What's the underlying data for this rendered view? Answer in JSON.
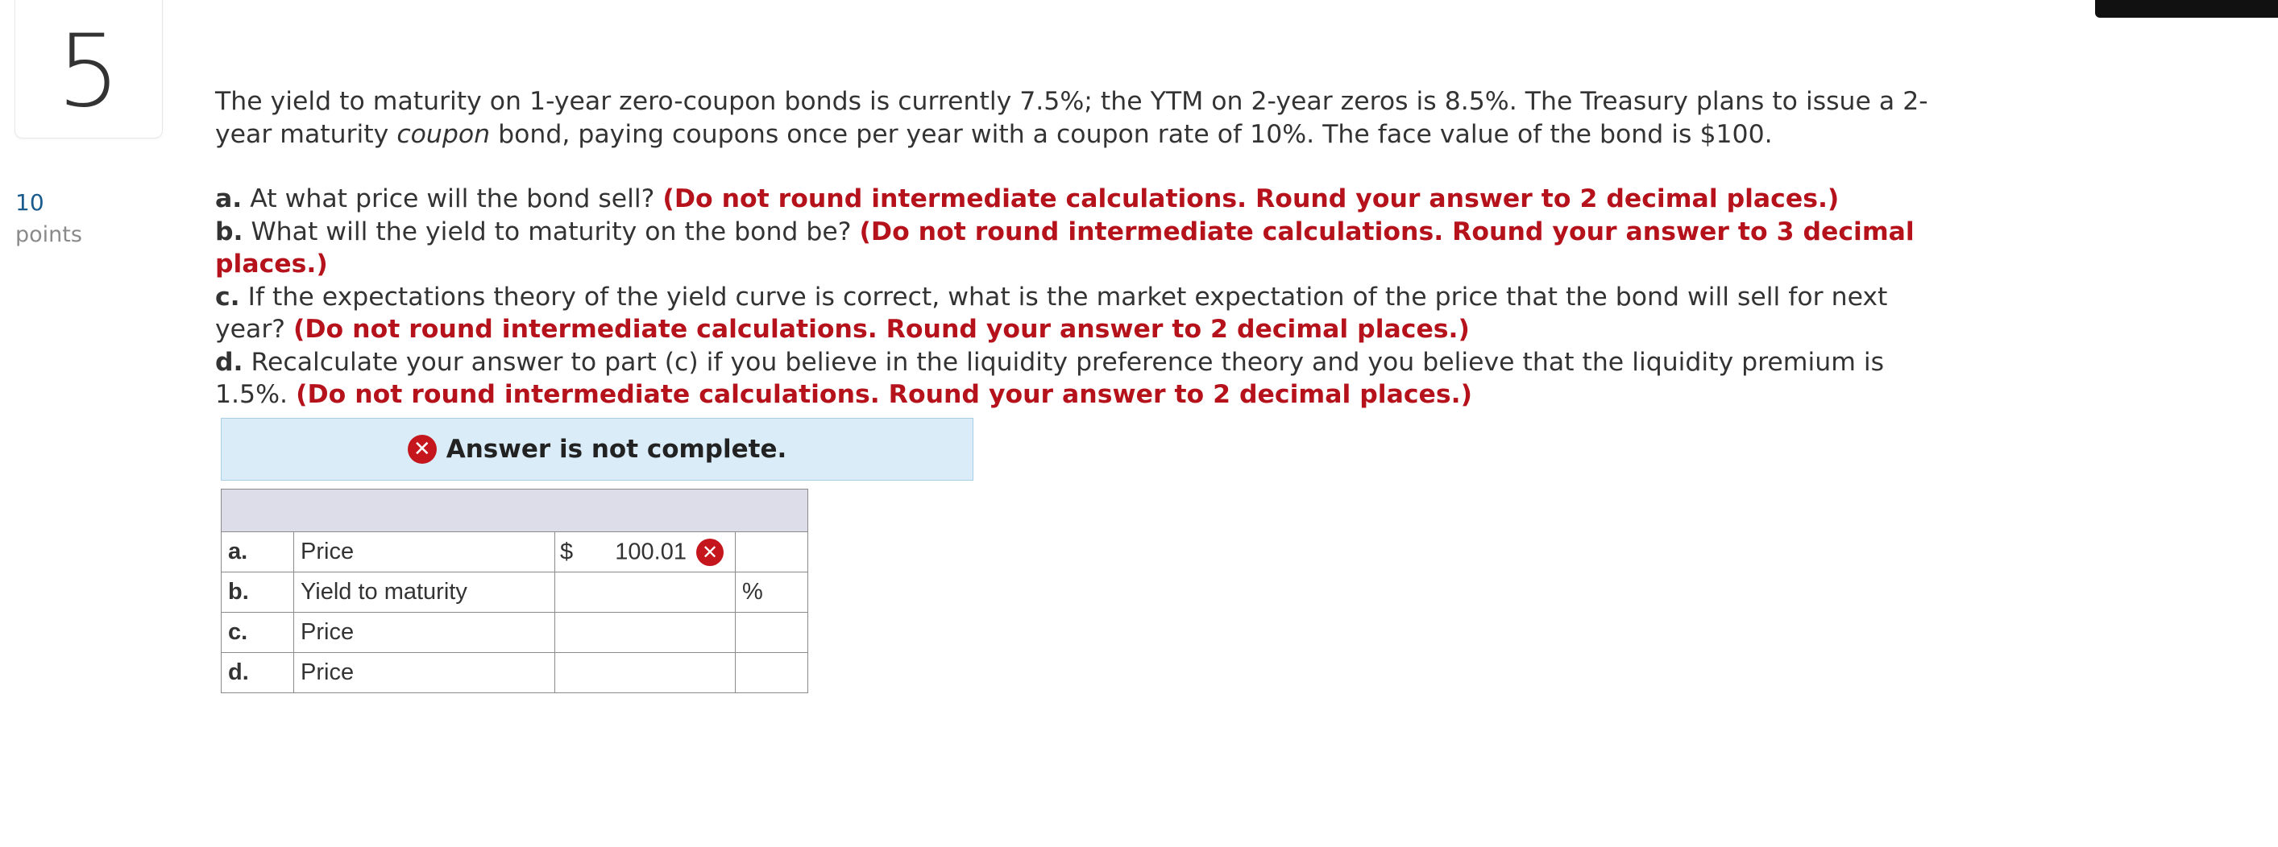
{
  "question": {
    "number": "5",
    "points_value": "10",
    "points_label": "points",
    "intro_line1": "The yield to maturity on 1-year zero-coupon bonds is currently 7.5%; the YTM on 2-year zeros is 8.5%. The Treasury plans to issue a 2-",
    "intro_line2_before": "year maturity ",
    "intro_line2_em": "coupon",
    "intro_line2_after": " bond, paying coupons once per year with a coupon rate of 10%. The face value of the bond is $100.",
    "parts": [
      {
        "label": "a.",
        "text": " At what price will the bond sell? ",
        "instruction": "(Do not round intermediate calculations. Round your answer to 2 decimal places.)"
      },
      {
        "label": "b.",
        "text": " What will the yield to maturity on the bond be? ",
        "instruction": "(Do not round intermediate calculations. Round your answer to 3 decimal places.)"
      },
      {
        "label": "c.",
        "text": " If the expectations theory of the yield curve is correct, what is the market expectation of the price that the bond will sell for next year? ",
        "instruction": "(Do not round intermediate calculations. Round your answer to 2 decimal places.)"
      },
      {
        "label": "d.",
        "text": " Recalculate your answer to part (c) if you believe in the liquidity preference theory and you believe that the liquidity premium is 1.5%. ",
        "instruction": "(Do not round intermediate calculations. Round your answer to 2 decimal places.)"
      }
    ]
  },
  "status": {
    "icon": "x-circle-icon",
    "text": "Answer is not complete.",
    "error_color": "#c4161c"
  },
  "answer_table": {
    "rows": [
      {
        "letter": "a.",
        "desc": "Price",
        "prefix": "$",
        "value": "100.01",
        "unit": "",
        "marked_wrong": true
      },
      {
        "letter": "b.",
        "desc": "Yield to maturity",
        "prefix": "",
        "value": "",
        "unit": "%",
        "marked_wrong": false
      },
      {
        "letter": "c.",
        "desc": "Price",
        "prefix": "",
        "value": "",
        "unit": "",
        "marked_wrong": false
      },
      {
        "letter": "d.",
        "desc": "Price",
        "prefix": "",
        "value": "",
        "unit": "",
        "marked_wrong": false
      }
    ]
  },
  "colors": {
    "instruction_red": "#b5121b",
    "points_blue": "#1a5b8e",
    "banner_bg": "#d9ecf8",
    "table_header_bg": "#dcdde8"
  }
}
